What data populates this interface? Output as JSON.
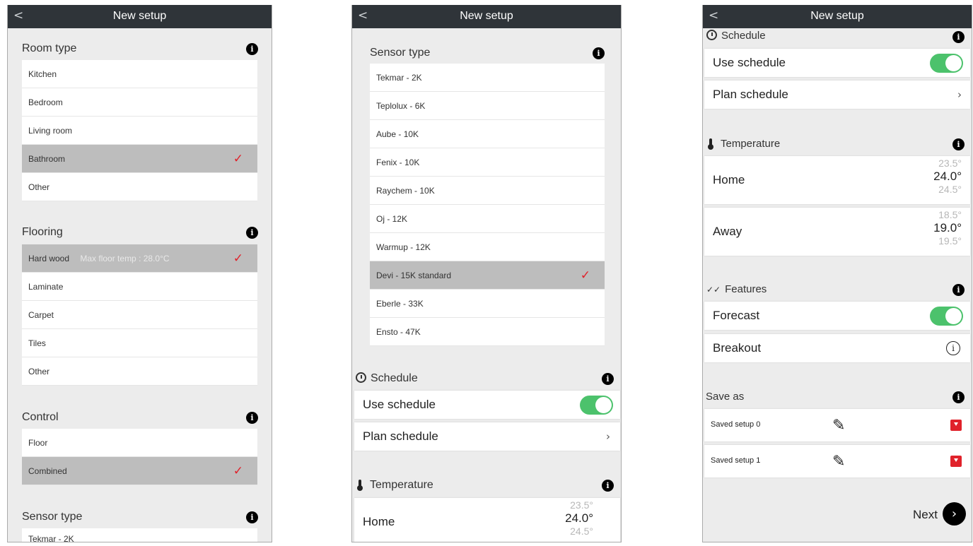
{
  "nav": {
    "title": "New setup",
    "back": "<"
  },
  "info_glyph": "i",
  "check_glyph": "✓",
  "screen1": {
    "room_type": {
      "title": "Room type",
      "items": [
        "Kitchen",
        "Bedroom",
        "Living room",
        "Bathroom",
        "Other"
      ],
      "selected": "Bathroom"
    },
    "flooring": {
      "title": "Flooring",
      "items": [
        "Hard wood",
        "Laminate",
        "Carpet",
        "Tiles",
        "Other"
      ],
      "selected": "Hard wood",
      "max_temp_note": "Max floor temp : 28.0°C"
    },
    "control": {
      "title": "Control",
      "items": [
        "Floor",
        "Combined"
      ],
      "selected": "Combined"
    },
    "sensor_type": {
      "title": "Sensor type",
      "first_item_partial": "Tekmar - 2K"
    }
  },
  "screen2": {
    "sensor_type": {
      "title": "Sensor type",
      "items": [
        "Tekmar - 2K",
        "Teplolux - 6K",
        "Aube - 10K",
        "Fenix - 10K",
        "Raychem - 10K",
        "Oj - 12K",
        "Warmup - 12K",
        "Devi - 15K standard",
        "Eberle - 33K",
        "Ensto - 47K"
      ],
      "selected": "Devi - 15K standard"
    },
    "schedule": {
      "title": "Schedule",
      "use_schedule": "Use schedule",
      "use_schedule_on": true,
      "plan_schedule": "Plan schedule"
    },
    "temperature": {
      "title": "Temperature",
      "home": {
        "label": "Home",
        "above": "23.5°",
        "value": "24.0°",
        "below": "24.5°"
      }
    }
  },
  "screen3": {
    "schedule": {
      "title": "Schedule",
      "use_schedule": "Use schedule",
      "use_schedule_on": true,
      "plan_schedule": "Plan schedule"
    },
    "temperature": {
      "title": "Temperature",
      "home": {
        "label": "Home",
        "above": "23.5°",
        "value": "24.0°",
        "below": "24.5°"
      },
      "away": {
        "label": "Away",
        "above": "18.5°",
        "value": "19.0°",
        "below": "19.5°"
      }
    },
    "features": {
      "title": "Features",
      "forecast": "Forecast",
      "forecast_on": true,
      "breakout": "Breakout"
    },
    "save_as": {
      "title": "Save as",
      "items": [
        "Saved setup 0",
        "Saved setup 1"
      ]
    },
    "next": "Next"
  },
  "colors": {
    "accent_check": "#e0222b",
    "toggle_on": "#4cc26c",
    "nav_bg": "#2f3439",
    "selected_row": "#bdbdbd"
  }
}
